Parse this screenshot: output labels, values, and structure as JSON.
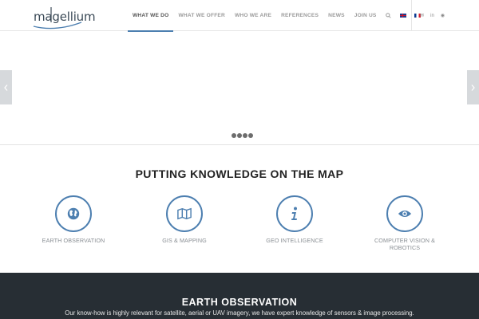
{
  "header": {
    "logo_text": "magellium",
    "nav": [
      {
        "label": "WHAT WE DO",
        "active": true
      },
      {
        "label": "WHAT WE OFFER",
        "active": false
      },
      {
        "label": "WHO WE ARE",
        "active": false
      },
      {
        "label": "REFERENCES",
        "active": false
      },
      {
        "label": "NEWS",
        "active": false
      },
      {
        "label": "JOIN US",
        "active": false
      }
    ],
    "search_icon": "search-icon",
    "languages": [
      "english-flag-icon",
      "french-flag-icon"
    ],
    "social": [
      {
        "icon": "mail-icon",
        "glyph": "✉"
      },
      {
        "icon": "linkedin-icon",
        "glyph": "in"
      },
      {
        "icon": "rss-icon",
        "glyph": "◉"
      }
    ]
  },
  "slider": {
    "prev_icon": "chevron-left-icon",
    "next_icon": "chevron-right-icon",
    "slide_count": 4
  },
  "intro": {
    "heading": "PUTTING KNOWLEDGE ON THE MAP",
    "features": [
      {
        "label": "EARTH OBSERVATION",
        "icon": "globe-icon"
      },
      {
        "label": "GIS & MAPPING",
        "icon": "map-icon"
      },
      {
        "label": "GEO INTELLIGENCE",
        "icon": "info-icon"
      },
      {
        "label": "COMPUTER VISION & ROBOTICS",
        "icon": "eye-icon"
      }
    ]
  },
  "band": {
    "title": "EARTH OBSERVATION",
    "text": "Our know-how is highly relevant for satellite, aerial or UAV imagery, we have expert knowledge of sensors & image processing."
  },
  "colors": {
    "accent": "#4d7fb0",
    "dark_band": "#272e34"
  }
}
